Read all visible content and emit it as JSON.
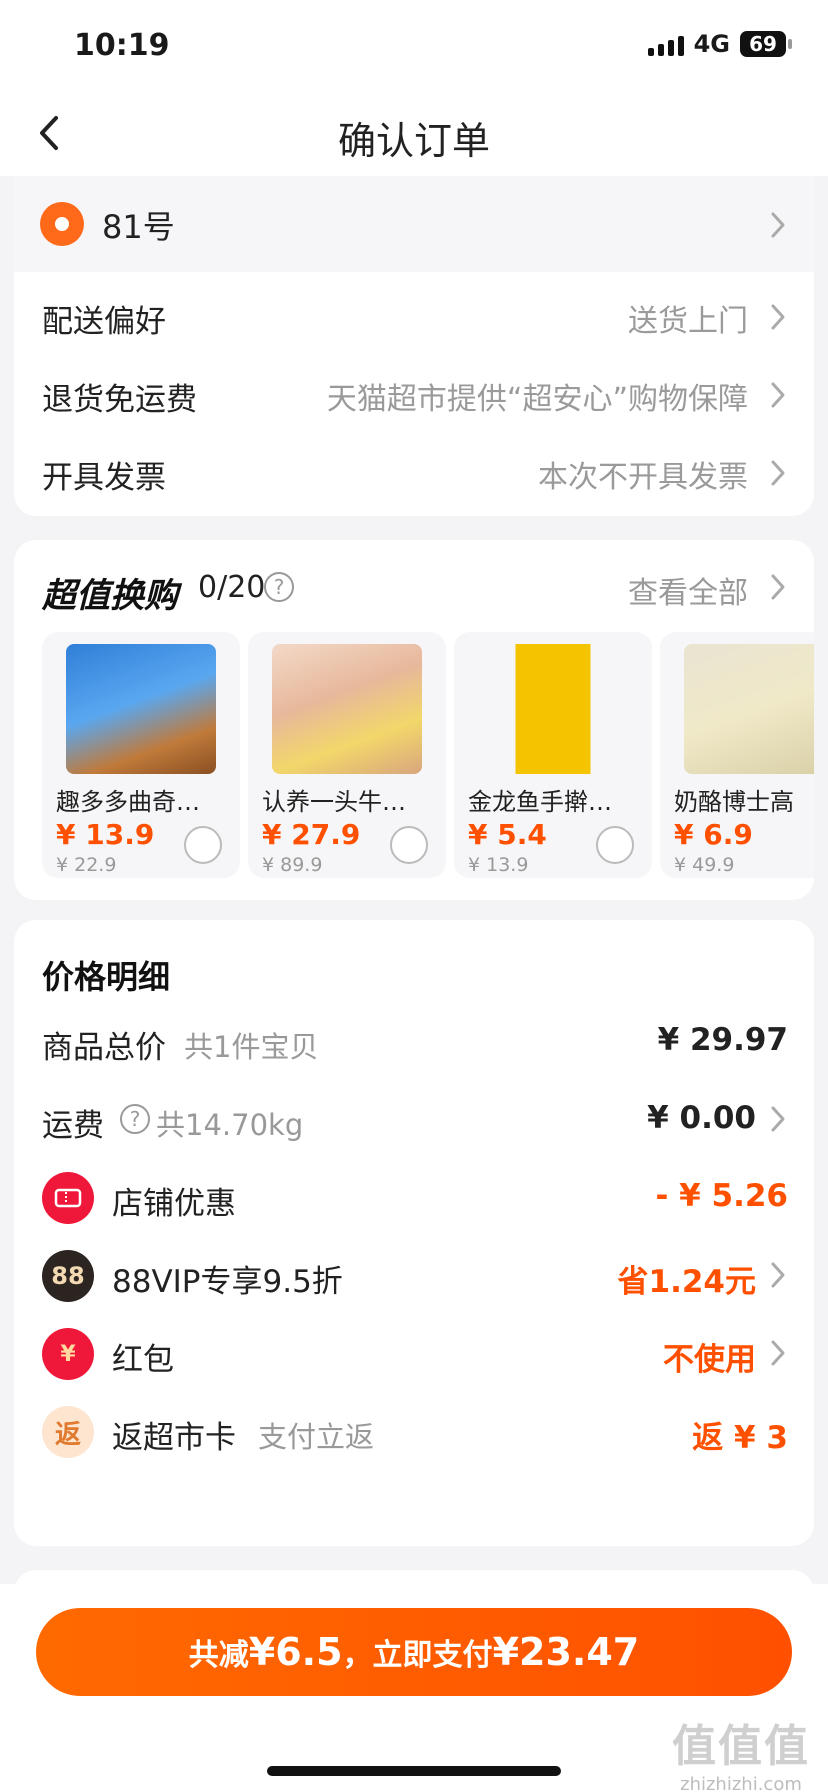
{
  "status_bar": {
    "time": "10:19",
    "network": "4G",
    "battery": "69"
  },
  "nav": {
    "title": "确认订单"
  },
  "address": {
    "text": "81号"
  },
  "preferences": [
    {
      "label": "配送偏好",
      "value": "送货上门"
    },
    {
      "label": "退货免运费",
      "value": "天猫超市提供“超安心”购物保障"
    },
    {
      "label": "开具发票",
      "value": "本次不开具发票"
    }
  ],
  "swap": {
    "title": "超值换购",
    "count": "0/20",
    "help": "?",
    "view_all": "查看全部",
    "products": [
      {
        "name": "趣多多曲奇…",
        "price": "¥ 13.9",
        "original": "¥ 22.9"
      },
      {
        "name": "认养一头牛…",
        "price": "¥ 27.9",
        "original": "¥ 89.9"
      },
      {
        "name": "金龙鱼手擀…",
        "price": "¥ 5.4",
        "original": "¥ 13.9"
      },
      {
        "name": "奶酪博士高",
        "price": "¥ 6.9",
        "original": "¥ 49.9"
      }
    ]
  },
  "price_detail": {
    "title": "价格明细",
    "goods_total": {
      "label": "商品总价",
      "sub": "共1件宝贝",
      "value": "¥ 29.97"
    },
    "shipping": {
      "label": "运费",
      "sub": "共14.70kg",
      "value": "¥ 0.00"
    },
    "store_discount": {
      "label": "店铺优惠",
      "value": "- ¥ 5.26"
    },
    "vip": {
      "label": "88VIP专享9.5折",
      "badge": "88",
      "value": "省1.24元"
    },
    "red_packet": {
      "label": "红包",
      "badge": "¥",
      "value": "不使用"
    },
    "card_rebate": {
      "label": "返超市卡",
      "sub": "支付立返",
      "badge": "返",
      "value": "返 ¥ 3"
    }
  },
  "pay": {
    "prefix": "共减",
    "reduce_amount": "¥6.5",
    "middle": "，立即支付",
    "pay_amount": "¥23.47"
  },
  "watermark": {
    "big": "值值值",
    "small": "zhizhizhi.com"
  },
  "colors": {
    "accent": "#ff5000",
    "background": "#f4f4f6"
  }
}
